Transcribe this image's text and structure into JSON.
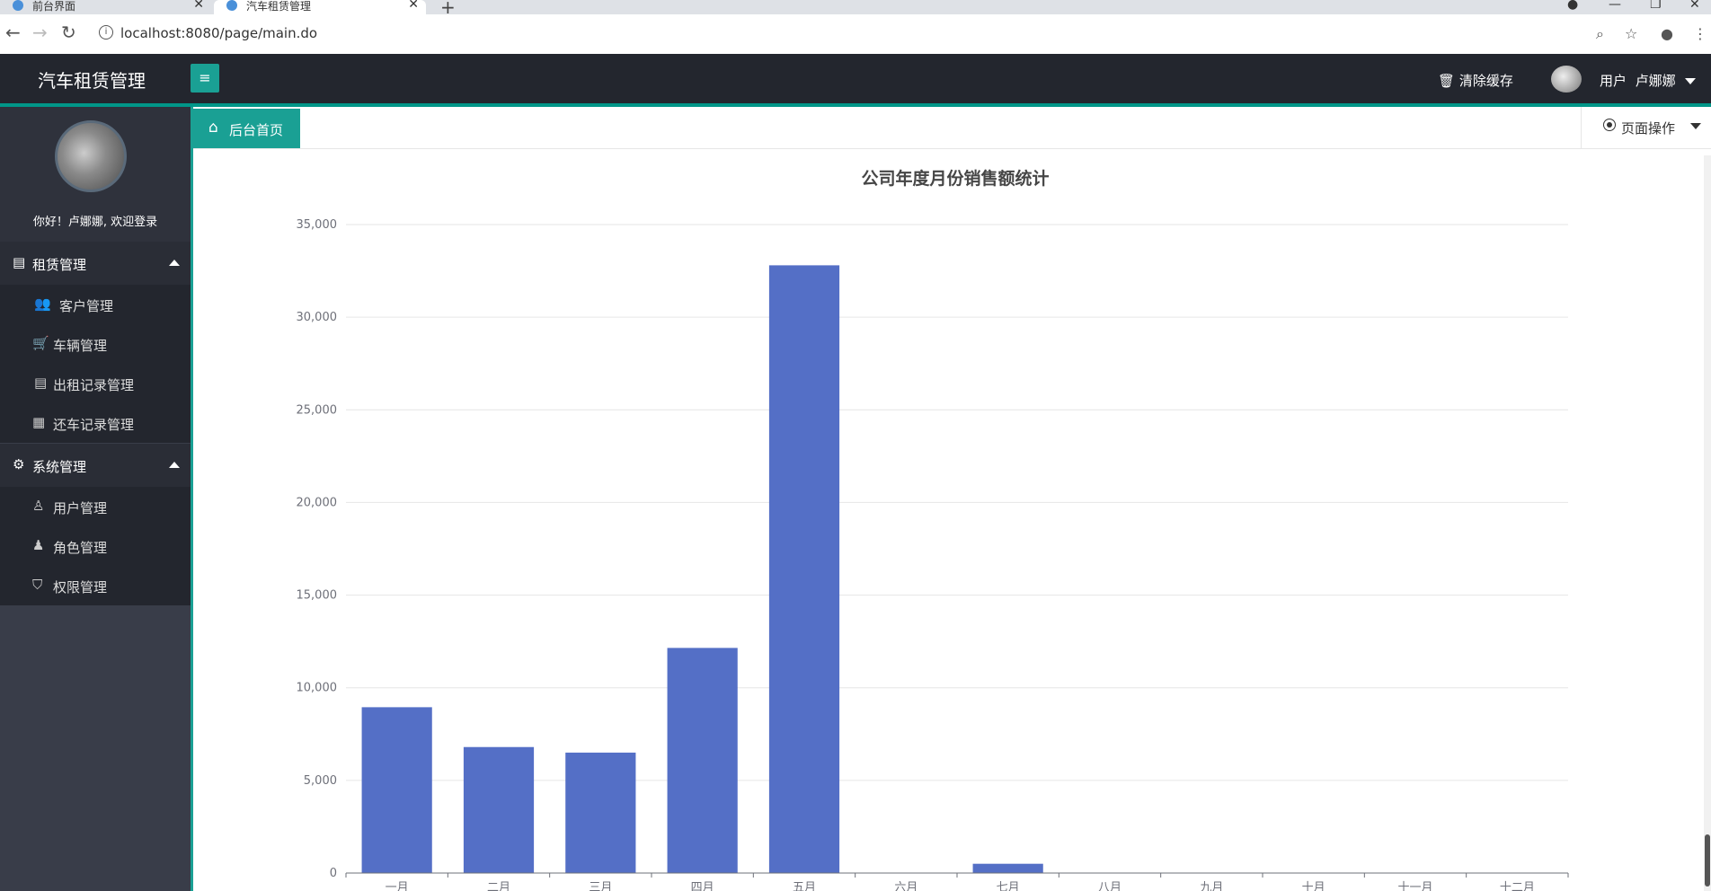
{
  "browser": {
    "tabs": [
      {
        "title": "前台界面"
      },
      {
        "title": "汽车租赁管理"
      }
    ],
    "url": "localhost:8080/page/main.do"
  },
  "header": {
    "brand": "汽车租赁管理",
    "clear_cache": "清除缓存",
    "user_label": "用户",
    "user_name": "卢娜娜"
  },
  "sidebar": {
    "welcome": "你好！卢娜娜, 欢迎登录",
    "groups": [
      {
        "label": "租赁管理",
        "items": [
          {
            "label": "客户管理",
            "icon": "users-icon"
          },
          {
            "label": "车辆管理",
            "icon": "cart-icon"
          },
          {
            "label": "出租记录管理",
            "icon": "file-icon"
          },
          {
            "label": "还车记录管理",
            "icon": "calendar-icon"
          }
        ]
      },
      {
        "label": "系统管理",
        "items": [
          {
            "label": "用户管理",
            "icon": "user-outline-icon"
          },
          {
            "label": "角色管理",
            "icon": "user-icon"
          },
          {
            "label": "权限管理",
            "icon": "shield-icon"
          }
        ]
      }
    ]
  },
  "main": {
    "home_tab": "后台首页",
    "page_ops": "页面操作"
  },
  "chart_data": {
    "type": "bar",
    "title": "公司年度月份销售额统计",
    "categories": [
      "一月",
      "二月",
      "三月",
      "四月",
      "五月",
      "六月",
      "七月",
      "八月",
      "九月",
      "十月",
      "十一月",
      "十二月"
    ],
    "values": [
      8950,
      6800,
      6500,
      12150,
      32800,
      0,
      500,
      0,
      0,
      0,
      0,
      0
    ],
    "ylim": [
      0,
      35000
    ],
    "yticks": [
      "0",
      "5,000",
      "10,000",
      "15,000",
      "20,000",
      "25,000",
      "30,000",
      "35,000"
    ],
    "grid": true,
    "bar_color": "#546fc6"
  }
}
